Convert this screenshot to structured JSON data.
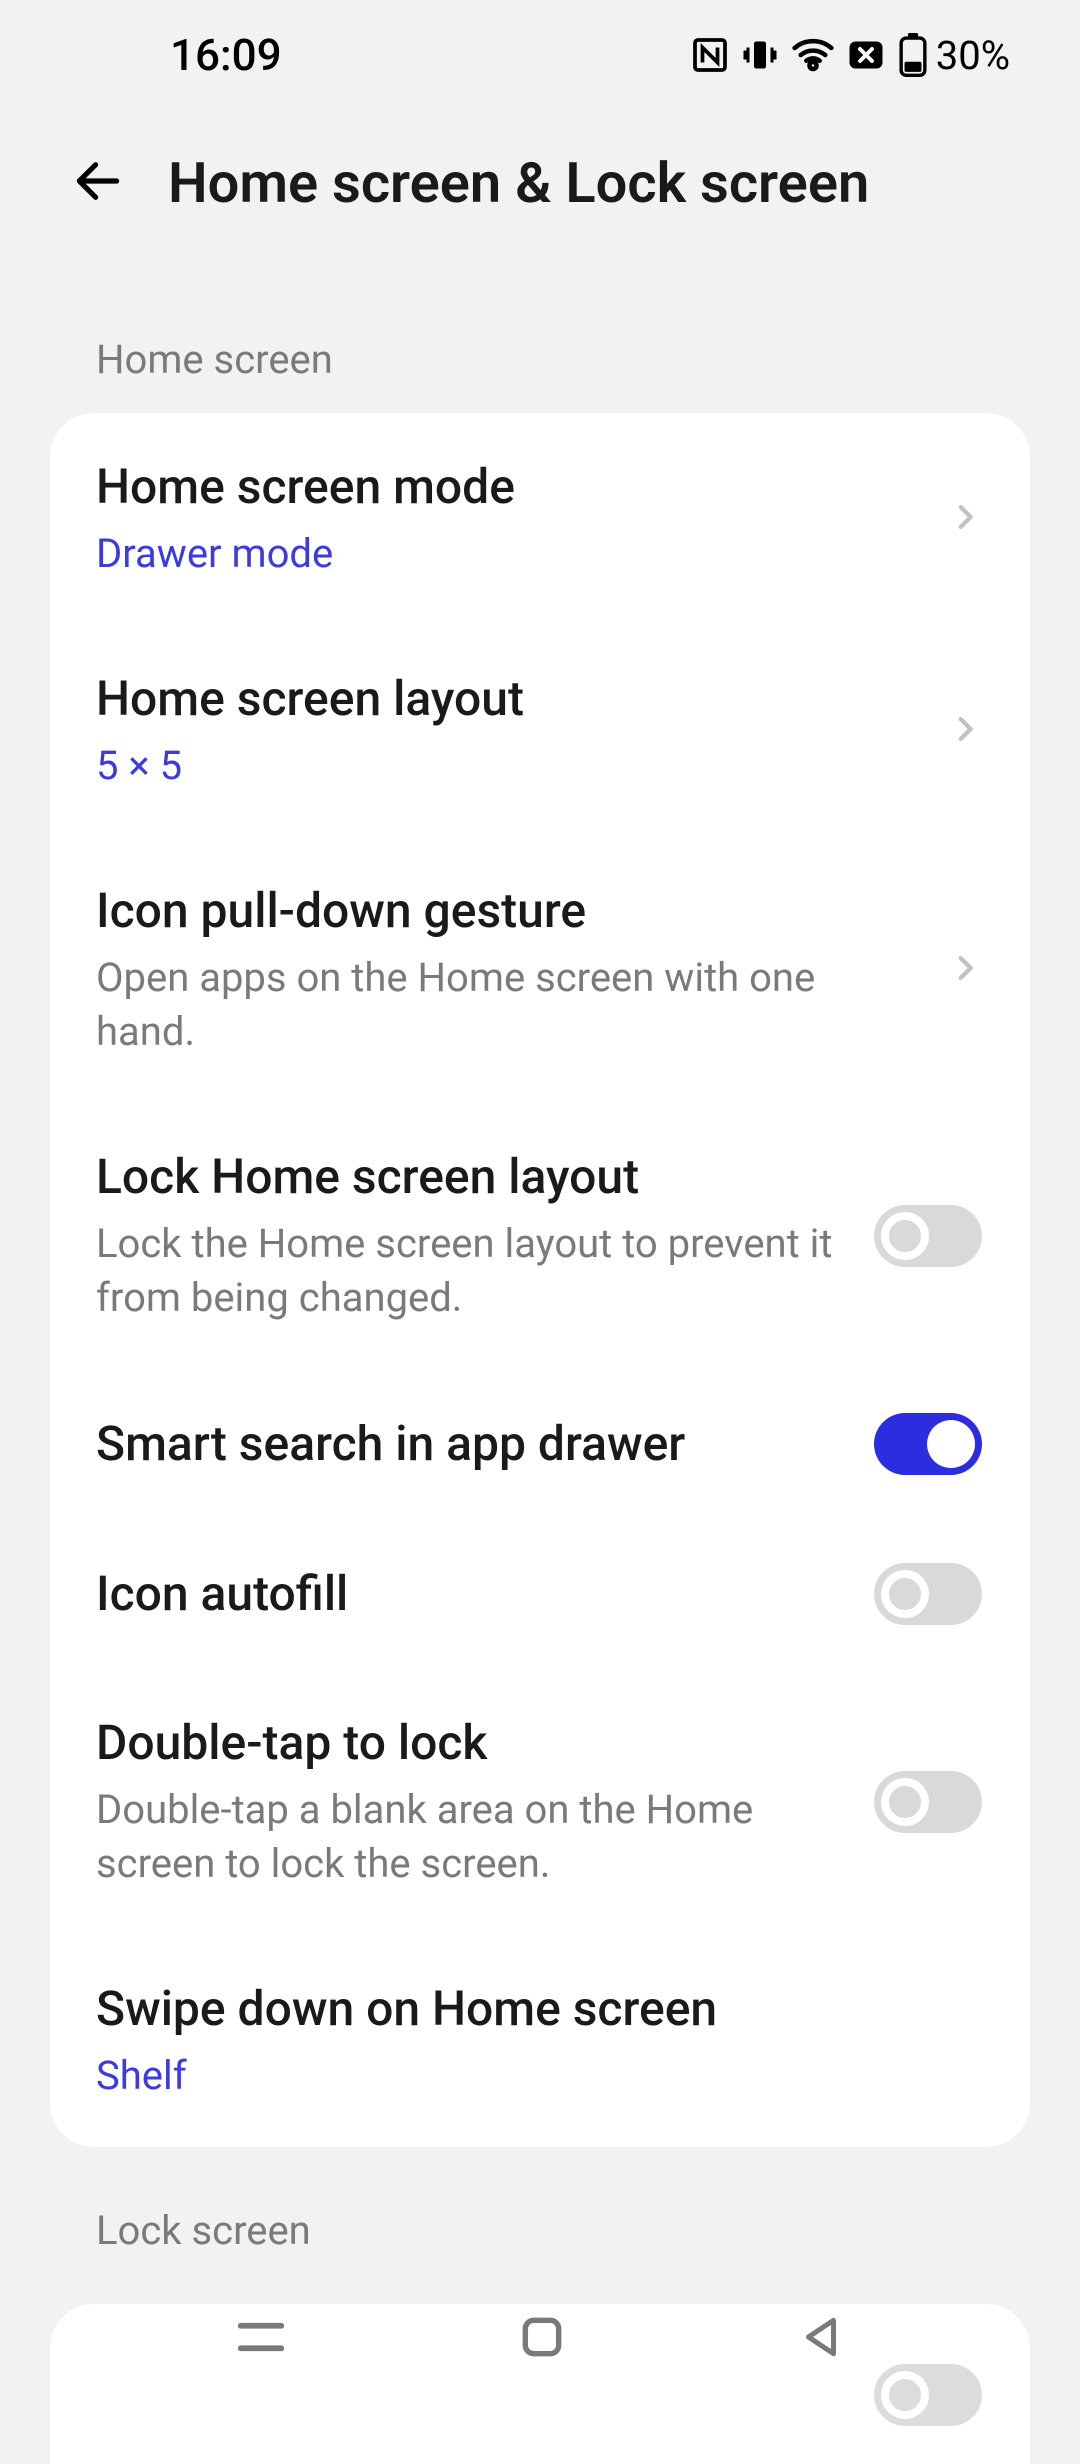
{
  "status": {
    "time": "16:09",
    "battery_text": "30%"
  },
  "header": {
    "title": "Home screen & Lock screen"
  },
  "sections": {
    "home_screen_label": "Home screen",
    "lock_screen_label": "Lock screen"
  },
  "rows": {
    "mode": {
      "title": "Home screen mode",
      "value": "Drawer mode"
    },
    "layout": {
      "title": "Home screen layout",
      "value": "5 × 5"
    },
    "icon_pull": {
      "title": "Icon pull-down gesture",
      "desc": "Open apps on the Home screen with one hand."
    },
    "lock_layout": {
      "title": "Lock Home screen layout",
      "desc": "Lock the Home screen layout to prevent it from being changed.",
      "on": false
    },
    "smart_search": {
      "title": "Smart search in app drawer",
      "on": true
    },
    "icon_autofill": {
      "title": "Icon autofill",
      "on": false
    },
    "double_tap": {
      "title": "Double-tap to lock",
      "desc": "Double-tap a blank area on the Home screen to lock the screen.",
      "on": false
    },
    "swipe_down": {
      "title": "Swipe down on Home screen",
      "value": "Shelf"
    }
  }
}
